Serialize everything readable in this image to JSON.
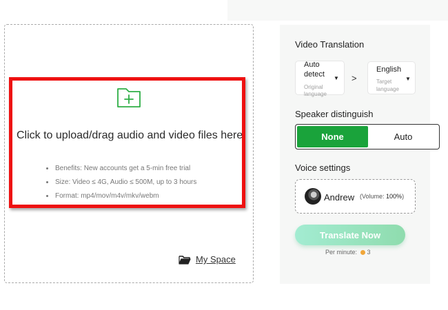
{
  "upload": {
    "title": "Click to upload/drag audio and video files here",
    "benefits": [
      "Benefits: New accounts get a 5-min free trial",
      "Size: Video ≤ 4G, Audio ≤ 500M, up to 3 hours",
      "Format: mp4/mov/m4v/mkv/webm"
    ],
    "my_space_label": "My Space",
    "icons": {
      "upload": "folder-add-icon",
      "my_space": "open-folder-icon"
    },
    "highlight_color": "#ee1111"
  },
  "panel": {
    "video_translation": {
      "title": "Video Translation",
      "source": {
        "value": "Auto detect",
        "value_line1": "Auto",
        "value_line2": "detect",
        "hint_line1": "Original",
        "hint_line2": "language"
      },
      "arrow": ">",
      "target": {
        "value": "English",
        "hint_line1": "Target",
        "hint_line2": "language"
      }
    },
    "speaker": {
      "title": "Speaker distinguish",
      "options": [
        "None",
        "Auto"
      ],
      "selected": "None",
      "accent": "#1aa33b"
    },
    "voice": {
      "title": "Voice settings",
      "name": "Andrew",
      "volume_prefix": "(Volume: ",
      "volume_value": "100%",
      "volume_suffix": ")"
    },
    "translate_label": "Translate Now",
    "per_minute_label": "Per minute:",
    "per_minute_cost": "3"
  }
}
